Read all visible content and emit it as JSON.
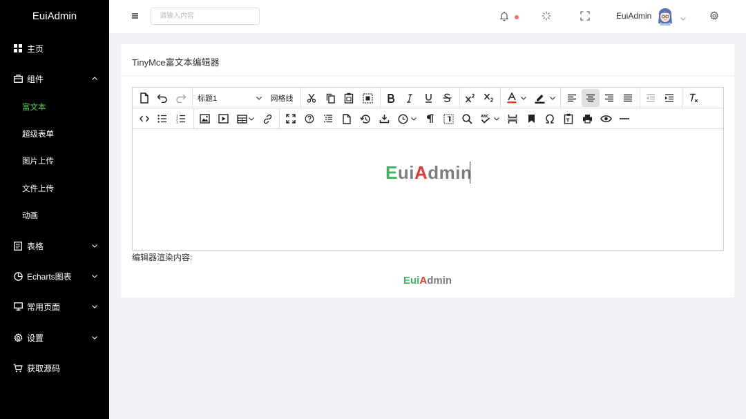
{
  "app": {
    "logo": "EuiAdmin"
  },
  "sidebar": {
    "items": [
      {
        "label": "主页",
        "icon": "grid-icon"
      },
      {
        "label": "组件",
        "icon": "briefcase-icon"
      },
      {
        "label": "表格",
        "icon": "document-icon"
      },
      {
        "label": "Echarts图表",
        "icon": "pie-chart-icon"
      },
      {
        "label": "常用页面",
        "icon": "monitor-icon"
      },
      {
        "label": "设置",
        "icon": "gear-icon"
      },
      {
        "label": "获取源码",
        "icon": "cart-icon"
      }
    ],
    "subitems": [
      "富文本",
      "超级表单",
      "图片上传",
      "文件上传",
      "动画"
    ],
    "active_subitem": "富文本",
    "colors": {
      "background": "#000000",
      "active": "#5fd35f"
    }
  },
  "header": {
    "search_placeholder": "请输入内容",
    "username": "EuiAdmin"
  },
  "card": {
    "title": "TinyMce富文本编辑器",
    "render_label": "编辑器渲染内容:"
  },
  "editor": {
    "block_format": "标题1",
    "grid_label": "网格线",
    "content": {
      "part1": "E",
      "part2": "ui",
      "part3": "A",
      "part4": "dmin"
    },
    "colors": {
      "green": "#3cb462",
      "red": "#e03a32",
      "gray": "#7d7d7d"
    }
  },
  "rendered": {
    "part1": "Eui",
    "part2": "A",
    "part3": "dmin"
  }
}
